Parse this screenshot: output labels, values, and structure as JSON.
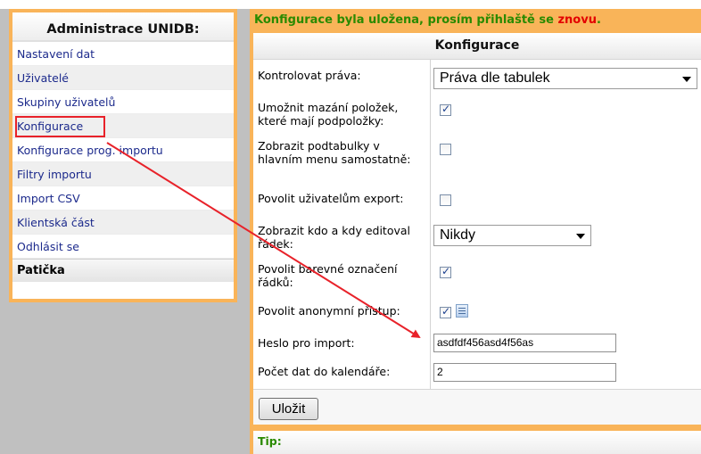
{
  "sidebar": {
    "title": "Administrace UNIDB:",
    "items": [
      {
        "label": "Nastavení dat"
      },
      {
        "label": "Uživatelé"
      },
      {
        "label": "Skupiny uživatelů"
      },
      {
        "label": "Konfigurace"
      },
      {
        "label": "Konfigurace prog. importu"
      },
      {
        "label": "Filtry importu"
      },
      {
        "label": "Import CSV"
      },
      {
        "label": "Klientská část"
      },
      {
        "label": "Odhlásit se"
      }
    ],
    "footer": "Patička"
  },
  "notice": {
    "text": "Konfigurace byla uložena, prosím přihlaště se ",
    "link": "znovu",
    "end": "."
  },
  "panel": {
    "title": "Konfigurace",
    "rows": {
      "check_rights": {
        "label": "Kontrolovat práva:",
        "value": "Práva dle tabulek"
      },
      "allow_delete": {
        "label": "Umožnit mazání položek, které mají podpoložky:",
        "checked": true
      },
      "show_subtables": {
        "label": "Zobrazit podtabulky v hlavním menu samostatně:",
        "checked": false
      },
      "allow_export": {
        "label": "Povolit uživatelům export:",
        "checked": false
      },
      "show_editor": {
        "label": "Zobrazit kdo a kdy editoval řádek:",
        "value": "Nikdy"
      },
      "row_color": {
        "label": "Povolit barevné označení řádků:",
        "checked": true
      },
      "anon_access": {
        "label": "Povolit anonymní přístup:",
        "checked": true
      },
      "import_password": {
        "label": "Heslo pro import:",
        "value": "asdfdf456asd4f56as"
      },
      "calendar_count": {
        "label": "Počet dat do kalendáře:",
        "value": "2"
      }
    },
    "save_label": "Uložit",
    "tip_label": "Tip:"
  },
  "colors": {
    "frame": "#f9b459",
    "link": "#1c2a8c",
    "notice": "#2a8a00",
    "alert": "#e30000",
    "annotation": "#e8222a"
  }
}
